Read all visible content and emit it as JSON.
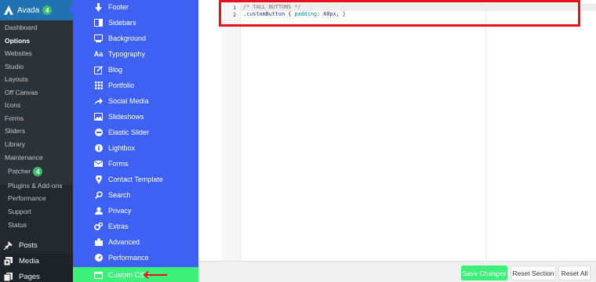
{
  "wp_menu": {
    "avada": {
      "label": "Avada",
      "badge": "4"
    },
    "sub_items": [
      {
        "label": "Dashboard"
      },
      {
        "label": "Options",
        "current": true
      },
      {
        "label": "Websites"
      },
      {
        "label": "Studio"
      },
      {
        "label": "Layouts"
      },
      {
        "label": "Off Canvas"
      },
      {
        "label": "Icons"
      },
      {
        "label": "Forms"
      },
      {
        "label": "Sliders"
      },
      {
        "label": "Library"
      },
      {
        "label": "Maintenance"
      },
      {
        "label": "Patcher",
        "badge": "4"
      },
      {
        "label": "Plugins & Add-ons"
      },
      {
        "label": "Performance"
      },
      {
        "label": "Support"
      },
      {
        "label": "Status"
      }
    ],
    "top_items": [
      {
        "label": "Posts",
        "icon": "pin-icon"
      },
      {
        "label": "Media",
        "icon": "media-icon"
      },
      {
        "label": "Pages",
        "icon": "pages-icon"
      }
    ]
  },
  "avada_sidebar": {
    "items": [
      {
        "label": "Footer",
        "icon": "arrow-down-icon"
      },
      {
        "label": "Sidebars",
        "icon": "sidebar-icon"
      },
      {
        "label": "Background",
        "icon": "background-icon"
      },
      {
        "label": "Typography",
        "icon": "typography-icon"
      },
      {
        "label": "Blog",
        "icon": "blog-icon"
      },
      {
        "label": "Portfolio",
        "icon": "grid-icon"
      },
      {
        "label": "Social Media",
        "icon": "share-icon"
      },
      {
        "label": "Slideshows",
        "icon": "image-icon"
      },
      {
        "label": "Elastic Slider",
        "icon": "minus-circle-icon"
      },
      {
        "label": "Lightbox",
        "icon": "info-icon"
      },
      {
        "label": "Forms",
        "icon": "envelope-icon"
      },
      {
        "label": "Contact Template",
        "icon": "map-pin-icon"
      },
      {
        "label": "Search",
        "icon": "search-icon"
      },
      {
        "label": "Privacy",
        "icon": "user-icon"
      },
      {
        "label": "Extras",
        "icon": "gears-icon"
      },
      {
        "label": "Advanced",
        "icon": "puzzle-icon"
      },
      {
        "label": "Performance",
        "icon": "gauge-icon"
      },
      {
        "label": "Custom CSS",
        "icon": "css-icon",
        "active": true
      }
    ]
  },
  "editor": {
    "line_numbers": [
      "1",
      "2"
    ],
    "line1": "/* TALL BUTTONS */",
    "line2": {
      "selector": ".customButton",
      "open": " { ",
      "property": "padding",
      "colon": ": ",
      "value": "60px",
      "close": "; }"
    }
  },
  "footer": {
    "save_label": "Save Changes",
    "reset_section_label": "Reset Section",
    "reset_all_label": "Reset All"
  },
  "colors": {
    "wp_menu_bg": "#1d2327",
    "wp_submenu_bg": "#2c3338",
    "wp_active": "#2271b1",
    "avada_sidebar_bg": "#3f61f3",
    "active_green": "#3cf07a",
    "annotation_red": "#e8101a"
  }
}
